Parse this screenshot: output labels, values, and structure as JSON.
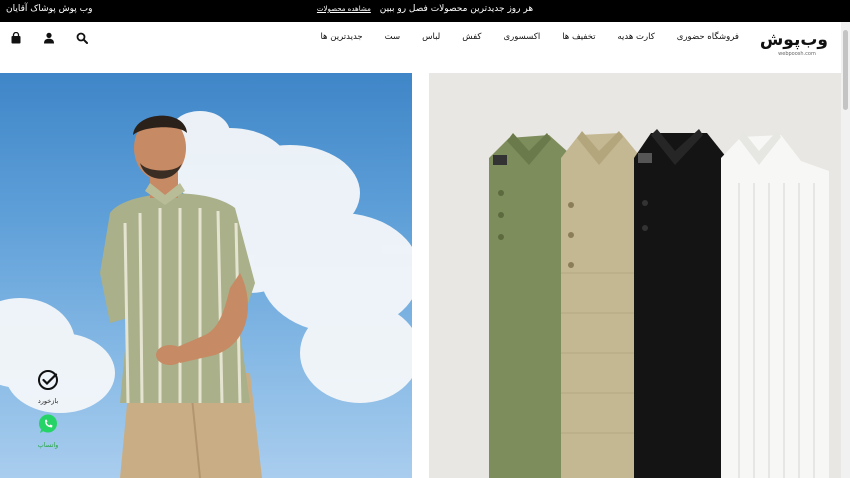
{
  "topbar": {
    "brand_note": "وب پوش پوشاک آقایان",
    "promo_text": "هر روز جدیدترین محصولات فصل رو ببین",
    "promo_link": "مشاهده محصولات"
  },
  "header": {
    "logo_text": "وب‌پوش",
    "logo_url": "webpoosh.com",
    "nav": [
      {
        "label": "جدیدترین ها"
      },
      {
        "label": "ست"
      },
      {
        "label": "لباس"
      },
      {
        "label": "کفش"
      },
      {
        "label": "اکسسوری"
      },
      {
        "label": "تخفیف ها"
      },
      {
        "label": "کارت هدیه"
      },
      {
        "label": "فروشگاه حضوری"
      }
    ],
    "icons": [
      "search-icon",
      "user-icon",
      "shopping-bag-icon"
    ]
  },
  "widgets": {
    "returns_label": "بازخورد",
    "whatsapp_label": "واتساپ"
  },
  "colors": {
    "topbar_bg": "#000000",
    "whatsapp": "#25d366",
    "sky": "#5e9fd8",
    "right_bg": "#e9e7e3"
  }
}
